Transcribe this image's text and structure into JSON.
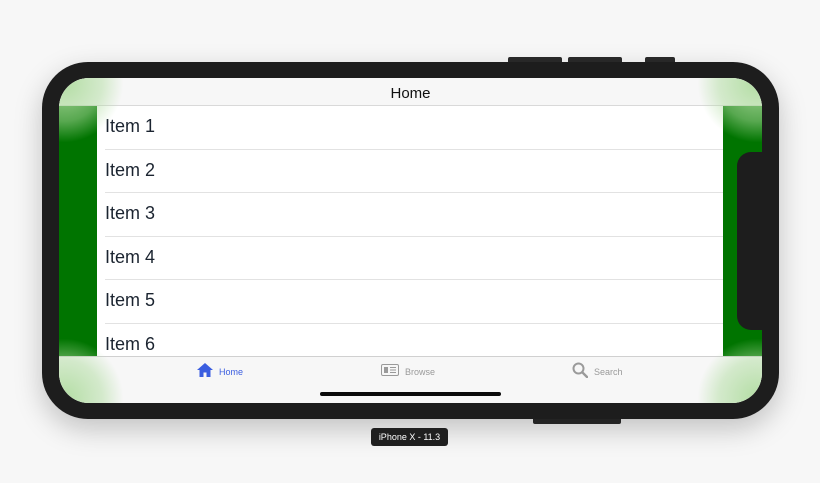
{
  "navigation": {
    "title": "Home"
  },
  "list": {
    "items": [
      {
        "label": "Item 1"
      },
      {
        "label": "Item 2"
      },
      {
        "label": "Item 3"
      },
      {
        "label": "Item 4"
      },
      {
        "label": "Item 5"
      },
      {
        "label": "Item 6"
      }
    ]
  },
  "tabbar": {
    "tabs": [
      {
        "label": "Home",
        "icon": "home-icon",
        "selected": true
      },
      {
        "label": "Browse",
        "icon": "browse-icon",
        "selected": false
      },
      {
        "label": "Search",
        "icon": "search-icon",
        "selected": false
      }
    ]
  },
  "simulator": {
    "label": "iPhone X - 11.3"
  },
  "colors": {
    "accent": "#3b5ee0",
    "side_panel": "#007400",
    "inactive_tab": "#9a9a9a"
  }
}
